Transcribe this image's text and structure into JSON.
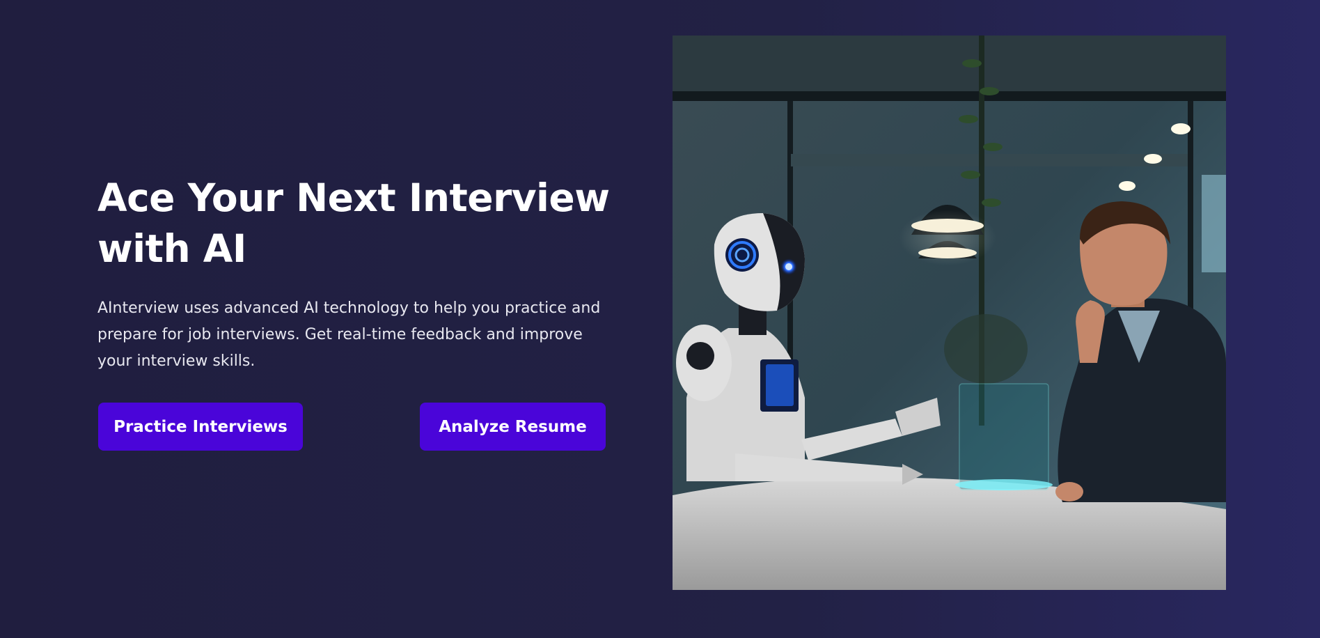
{
  "hero": {
    "title_line1": "Ace Your Next Interview",
    "title_line2": "with AI",
    "description": "AInterview uses advanced AI technology to help you practice and prepare for job interviews. Get real-time feedback and improve your interview skills.",
    "buttons": {
      "practice": "Practice Interviews",
      "resume": "Analyze Resume"
    },
    "image": {
      "subject": "robot interviewing a man at a table in an office"
    }
  },
  "colors": {
    "background": "#222145",
    "button": "#4a05d9",
    "text": "#ffffff"
  }
}
